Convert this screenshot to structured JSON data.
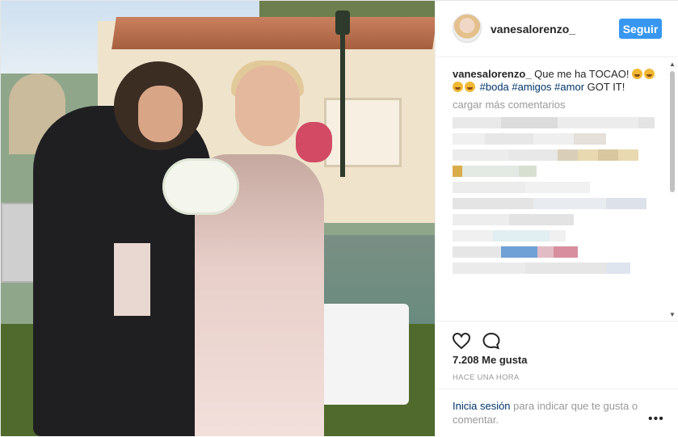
{
  "post": {
    "username": "vanesalorenzo_",
    "follow_label": "Seguir",
    "caption": {
      "user": "vanesalorenzo_",
      "text": "Que me ha TOCAO!",
      "tags": [
        "#boda",
        "#amigos",
        "#amor"
      ],
      "trailing": "GOT IT!"
    },
    "load_more": "cargar más comentarios",
    "likes": "7.208 Me gusta",
    "time": "HACE UNA HORA",
    "login": {
      "link": "Inicia sesión",
      "text": "para indicar que te gusta o comentar."
    },
    "more_icon": "•••"
  },
  "colors": {
    "follow_button": "#3897f0",
    "link": "#003569",
    "muted": "#999999"
  },
  "icons": {
    "like": "heart-outline-icon",
    "comment": "speech-bubble-icon",
    "more": "ellipsis-icon"
  }
}
